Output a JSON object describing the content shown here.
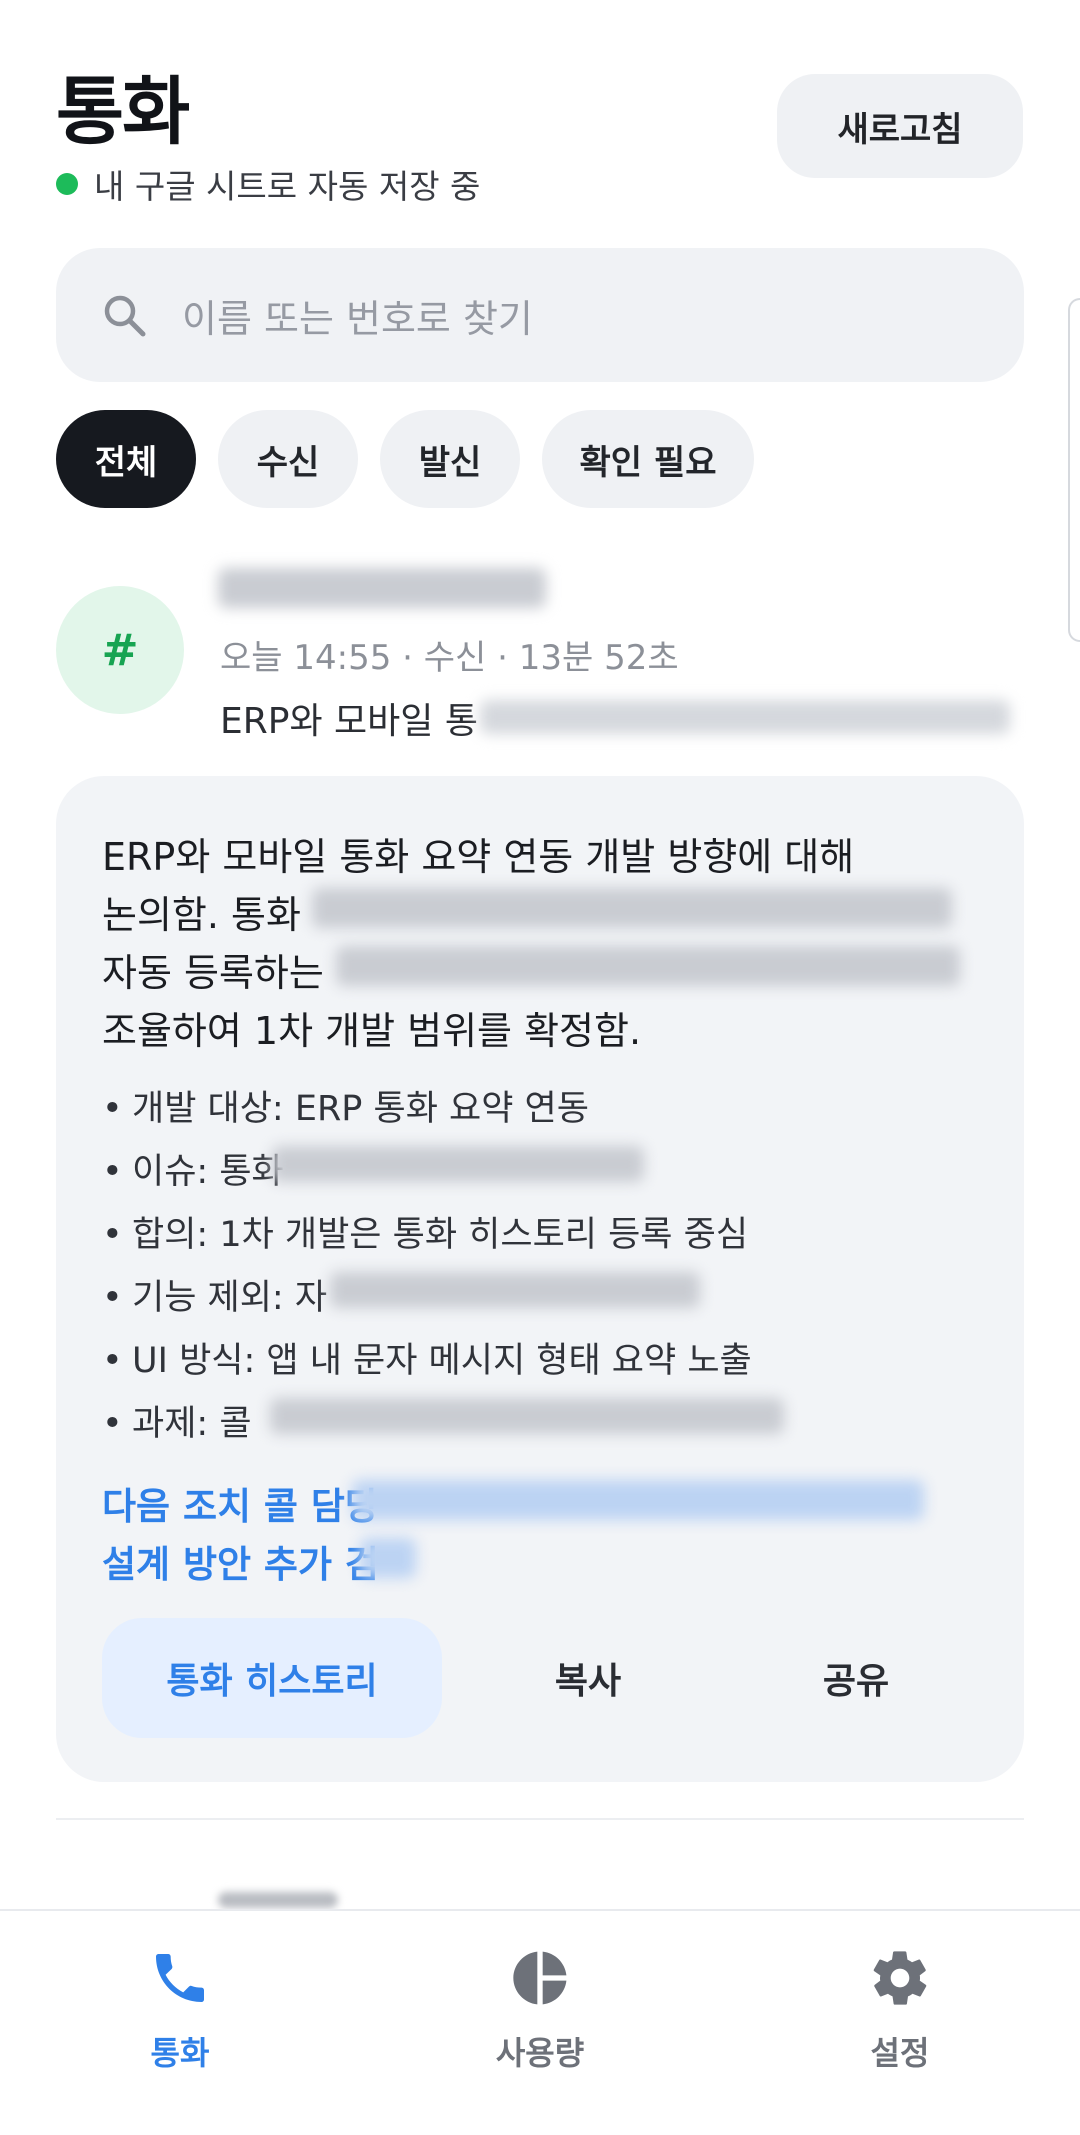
{
  "header": {
    "title": "통화",
    "status_text": "내 구글 시트로 자동 저장 중",
    "status_color": "#1dbb5a",
    "refresh_label": "새로고침"
  },
  "search": {
    "placeholder": "이름 또는 번호로 찾기",
    "icon": "search-icon"
  },
  "filters": [
    {
      "label": "전체",
      "active": true
    },
    {
      "label": "수신",
      "active": false
    },
    {
      "label": "발신",
      "active": false
    },
    {
      "label": "확인 필요",
      "active": false
    }
  ],
  "call": {
    "avatar_symbol": "#",
    "meta": "오늘 14:55 · 수신 · 13분 52초",
    "preview": "ERP와 모바일 통"
  },
  "summary": {
    "lines": [
      "ERP와 모바일 통화 요약 연동 개발 방향에 대해",
      "논의함. 통화",
      "자동 등록하는",
      "조율하여 1차 개발 범위를 확정함."
    ],
    "bullets": [
      "개발 대상: ERP 통화 요약 연동",
      "이슈: 통화",
      "합의: 1차 개발은 통화 히스토리 등록 중심",
      "기능 제외: 자",
      "UI 방식: 앱 내 문자 메시지 형태 요약 노출",
      "과제: 콜"
    ],
    "next_action_line1": "다음 조치  콜 담당",
    "next_action_line2": "설계 방안 추가 검",
    "actions": {
      "history": "통화 히스토리",
      "copy": "복사",
      "share": "공유"
    }
  },
  "nav": {
    "calls": "통화",
    "usage": "사용량",
    "settings": "설정",
    "active_color": "#2f80e8",
    "inactive_color": "#6d7179"
  }
}
